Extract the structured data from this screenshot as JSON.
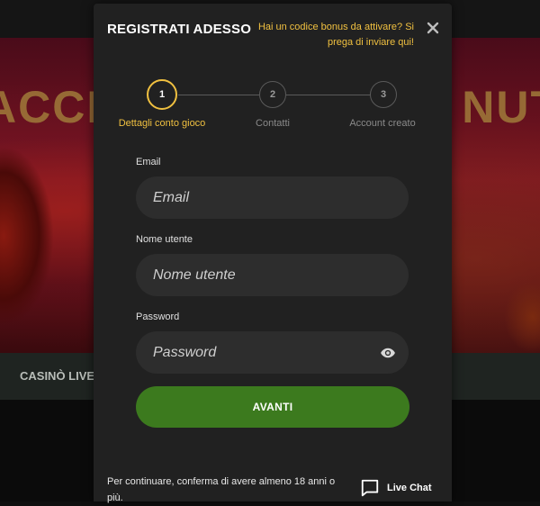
{
  "background": {
    "banner_text_left": "ACCH",
    "banner_text_right": "NUT",
    "nav_item": "CASINÒ LIVE"
  },
  "modal": {
    "title": "REGISTRATI ADESSO",
    "bonus_link": "Hai un codice bonus da attivare? Si prega di inviare qui!",
    "close_icon": "close-icon"
  },
  "stepper": {
    "steps": [
      {
        "number": "1",
        "label": "Dettagli conto gioco",
        "active": true
      },
      {
        "number": "2",
        "label": "Contatti",
        "active": false
      },
      {
        "number": "3",
        "label": "Account creato",
        "active": false
      }
    ]
  },
  "form": {
    "email": {
      "label": "Email",
      "placeholder": "Email",
      "value": ""
    },
    "username": {
      "label": "Nome utente",
      "placeholder": "Nome utente",
      "value": ""
    },
    "password": {
      "label": "Password",
      "placeholder": "Password",
      "value": "",
      "toggle_icon": "eye-icon"
    },
    "submit_label": "AVANTI"
  },
  "footer": {
    "age_note": "Per continuare, conferma di avere almeno 18 anni o più.",
    "livechat_label": "Live Chat",
    "livechat_icon": "chat-bubble-icon"
  },
  "colors": {
    "accent": "#f0c040",
    "button": "#3c7a1e",
    "modal_bg": "#212121",
    "field_bg": "#2d2d2d"
  }
}
